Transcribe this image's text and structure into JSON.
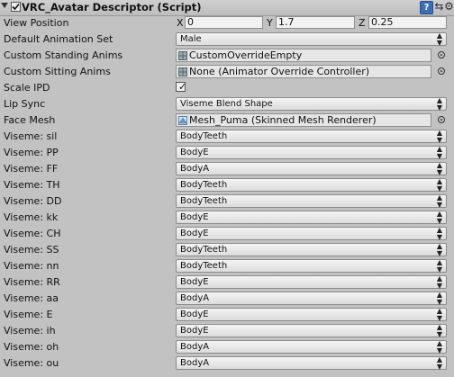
{
  "component": {
    "title": "VRC_Avatar Descriptor (Script)",
    "enabled": true,
    "icons": [
      "help-icon",
      "preset-icon",
      "gear-icon"
    ]
  },
  "view_position": {
    "label": "View Position",
    "x_label": "X",
    "x": "0",
    "y_label": "Y",
    "y": "1.7",
    "z_label": "Z",
    "z": "0.25"
  },
  "default_animation_set": {
    "label": "Default Animation Set",
    "value": "Male"
  },
  "custom_standing_anims": {
    "label": "Custom Standing Anims",
    "value": "CustomOverrideEmpty"
  },
  "custom_sitting_anims": {
    "label": "Custom Sitting Anims",
    "value": "None (Animator Override Controller)"
  },
  "scale_ipd": {
    "label": "Scale IPD",
    "checked": true,
    "tick": "✓"
  },
  "lip_sync": {
    "label": "Lip Sync",
    "value": "Viseme Blend Shape"
  },
  "face_mesh": {
    "label": "Face Mesh",
    "value": "Mesh_Puma (Skinned Mesh Renderer)"
  },
  "visemes": [
    {
      "label": "Viseme: sil",
      "value": "BodyTeeth"
    },
    {
      "label": "Viseme: PP",
      "value": "BodyE"
    },
    {
      "label": "Viseme: FF",
      "value": "BodyA"
    },
    {
      "label": "Viseme: TH",
      "value": "BodyTeeth"
    },
    {
      "label": "Viseme: DD",
      "value": "BodyTeeth"
    },
    {
      "label": "Viseme: kk",
      "value": "BodyE"
    },
    {
      "label": "Viseme: CH",
      "value": "BodyE"
    },
    {
      "label": "Viseme: SS",
      "value": "BodyTeeth"
    },
    {
      "label": "Viseme: nn",
      "value": "BodyTeeth"
    },
    {
      "label": "Viseme: RR",
      "value": "BodyE"
    },
    {
      "label": "Viseme: aa",
      "value": "BodyA"
    },
    {
      "label": "Viseme: E",
      "value": "BodyE"
    },
    {
      "label": "Viseme: ih",
      "value": "BodyE"
    },
    {
      "label": "Viseme: oh",
      "value": "BodyA"
    },
    {
      "label": "Viseme: ou",
      "value": "BodyA"
    }
  ],
  "colors": {
    "background": "#c2c2c2",
    "help_icon": "#3a6fb7"
  }
}
